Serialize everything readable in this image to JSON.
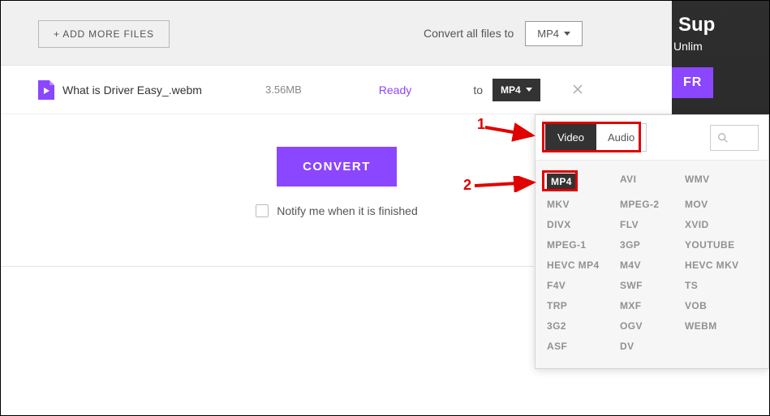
{
  "topbar": {
    "add_more_label": "+ ADD MORE FILES",
    "convert_all_text": "Convert all files to",
    "convert_all_target": "MP4"
  },
  "file": {
    "name": "What is Driver Easy_.webm",
    "size": "3.56MB",
    "status": "Ready",
    "to_label": "to",
    "target": "MP4"
  },
  "actions": {
    "convert_label": "CONVERT",
    "notify_label": "Notify me when it is finished"
  },
  "right_banner": {
    "title": "Sup",
    "subtitle": "Unlim",
    "cta": "FR"
  },
  "dropdown": {
    "tabs": {
      "video": "Video",
      "audio": "Audio"
    },
    "search_placeholder": ""
  },
  "formats": {
    "col1": [
      "MP4",
      "MKV",
      "DIVX",
      "MPEG-1",
      "HEVC MP4",
      "F4V",
      "TRP",
      "3G2",
      "ASF"
    ],
    "col2": [
      "AVI",
      "MPEG-2",
      "FLV",
      "3GP",
      "M4V",
      "SWF",
      "MXF",
      "OGV",
      "DV"
    ],
    "col3": [
      "WMV",
      "MOV",
      "XVID",
      "YOUTUBE",
      "HEVC MKV",
      "TS",
      "VOB",
      "WEBM",
      ""
    ]
  },
  "annotations": {
    "one": "1",
    "two": "2"
  }
}
